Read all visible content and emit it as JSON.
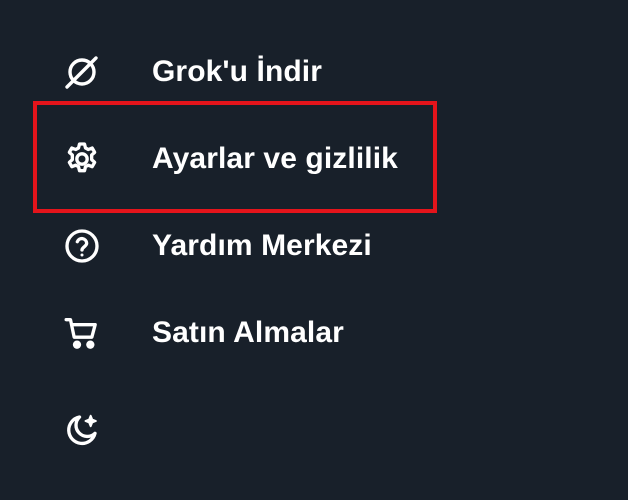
{
  "menu": {
    "items": [
      {
        "label": "Grok'u İndir",
        "icon": "grok-icon"
      },
      {
        "label": "Ayarlar ve gizlilik",
        "icon": "gear-icon"
      },
      {
        "label": "Yardım Merkezi",
        "icon": "help-circle-icon"
      },
      {
        "label": "Satın Almalar",
        "icon": "cart-icon"
      },
      {
        "label": "",
        "icon": "moon-sparkle-icon"
      }
    ]
  },
  "highlight": {
    "color": "#e4141b",
    "target": "Ayarlar ve gizlilik"
  },
  "theme": {
    "background": "#18202a",
    "text": "#ffffff"
  }
}
